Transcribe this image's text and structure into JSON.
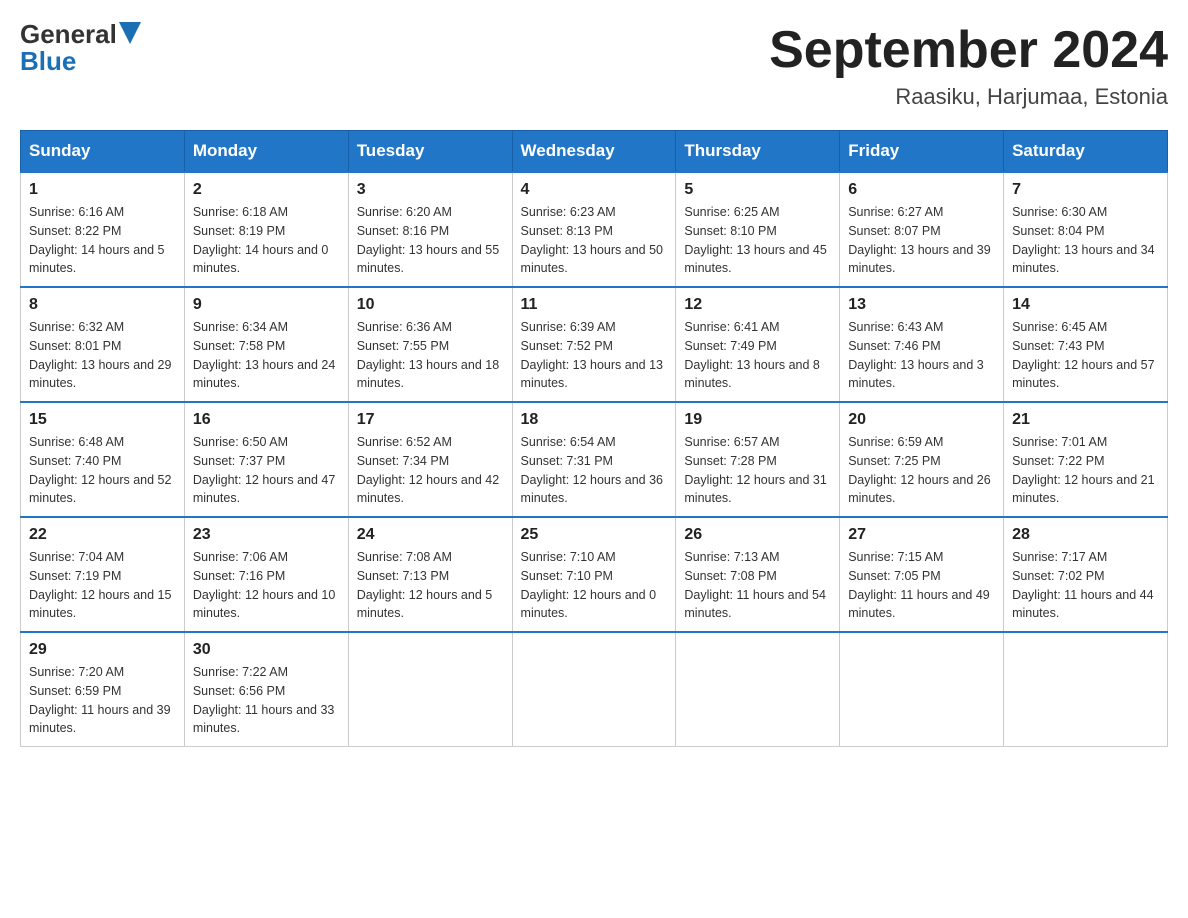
{
  "header": {
    "logo_general": "General",
    "logo_blue": "Blue",
    "title": "September 2024",
    "subtitle": "Raasiku, Harjumaa, Estonia"
  },
  "columns": [
    "Sunday",
    "Monday",
    "Tuesday",
    "Wednesday",
    "Thursday",
    "Friday",
    "Saturday"
  ],
  "weeks": [
    [
      {
        "day": "1",
        "sunrise": "Sunrise: 6:16 AM",
        "sunset": "Sunset: 8:22 PM",
        "daylight": "Daylight: 14 hours and 5 minutes."
      },
      {
        "day": "2",
        "sunrise": "Sunrise: 6:18 AM",
        "sunset": "Sunset: 8:19 PM",
        "daylight": "Daylight: 14 hours and 0 minutes."
      },
      {
        "day": "3",
        "sunrise": "Sunrise: 6:20 AM",
        "sunset": "Sunset: 8:16 PM",
        "daylight": "Daylight: 13 hours and 55 minutes."
      },
      {
        "day": "4",
        "sunrise": "Sunrise: 6:23 AM",
        "sunset": "Sunset: 8:13 PM",
        "daylight": "Daylight: 13 hours and 50 minutes."
      },
      {
        "day": "5",
        "sunrise": "Sunrise: 6:25 AM",
        "sunset": "Sunset: 8:10 PM",
        "daylight": "Daylight: 13 hours and 45 minutes."
      },
      {
        "day": "6",
        "sunrise": "Sunrise: 6:27 AM",
        "sunset": "Sunset: 8:07 PM",
        "daylight": "Daylight: 13 hours and 39 minutes."
      },
      {
        "day": "7",
        "sunrise": "Sunrise: 6:30 AM",
        "sunset": "Sunset: 8:04 PM",
        "daylight": "Daylight: 13 hours and 34 minutes."
      }
    ],
    [
      {
        "day": "8",
        "sunrise": "Sunrise: 6:32 AM",
        "sunset": "Sunset: 8:01 PM",
        "daylight": "Daylight: 13 hours and 29 minutes."
      },
      {
        "day": "9",
        "sunrise": "Sunrise: 6:34 AM",
        "sunset": "Sunset: 7:58 PM",
        "daylight": "Daylight: 13 hours and 24 minutes."
      },
      {
        "day": "10",
        "sunrise": "Sunrise: 6:36 AM",
        "sunset": "Sunset: 7:55 PM",
        "daylight": "Daylight: 13 hours and 18 minutes."
      },
      {
        "day": "11",
        "sunrise": "Sunrise: 6:39 AM",
        "sunset": "Sunset: 7:52 PM",
        "daylight": "Daylight: 13 hours and 13 minutes."
      },
      {
        "day": "12",
        "sunrise": "Sunrise: 6:41 AM",
        "sunset": "Sunset: 7:49 PM",
        "daylight": "Daylight: 13 hours and 8 minutes."
      },
      {
        "day": "13",
        "sunrise": "Sunrise: 6:43 AM",
        "sunset": "Sunset: 7:46 PM",
        "daylight": "Daylight: 13 hours and 3 minutes."
      },
      {
        "day": "14",
        "sunrise": "Sunrise: 6:45 AM",
        "sunset": "Sunset: 7:43 PM",
        "daylight": "Daylight: 12 hours and 57 minutes."
      }
    ],
    [
      {
        "day": "15",
        "sunrise": "Sunrise: 6:48 AM",
        "sunset": "Sunset: 7:40 PM",
        "daylight": "Daylight: 12 hours and 52 minutes."
      },
      {
        "day": "16",
        "sunrise": "Sunrise: 6:50 AM",
        "sunset": "Sunset: 7:37 PM",
        "daylight": "Daylight: 12 hours and 47 minutes."
      },
      {
        "day": "17",
        "sunrise": "Sunrise: 6:52 AM",
        "sunset": "Sunset: 7:34 PM",
        "daylight": "Daylight: 12 hours and 42 minutes."
      },
      {
        "day": "18",
        "sunrise": "Sunrise: 6:54 AM",
        "sunset": "Sunset: 7:31 PM",
        "daylight": "Daylight: 12 hours and 36 minutes."
      },
      {
        "day": "19",
        "sunrise": "Sunrise: 6:57 AM",
        "sunset": "Sunset: 7:28 PM",
        "daylight": "Daylight: 12 hours and 31 minutes."
      },
      {
        "day": "20",
        "sunrise": "Sunrise: 6:59 AM",
        "sunset": "Sunset: 7:25 PM",
        "daylight": "Daylight: 12 hours and 26 minutes."
      },
      {
        "day": "21",
        "sunrise": "Sunrise: 7:01 AM",
        "sunset": "Sunset: 7:22 PM",
        "daylight": "Daylight: 12 hours and 21 minutes."
      }
    ],
    [
      {
        "day": "22",
        "sunrise": "Sunrise: 7:04 AM",
        "sunset": "Sunset: 7:19 PM",
        "daylight": "Daylight: 12 hours and 15 minutes."
      },
      {
        "day": "23",
        "sunrise": "Sunrise: 7:06 AM",
        "sunset": "Sunset: 7:16 PM",
        "daylight": "Daylight: 12 hours and 10 minutes."
      },
      {
        "day": "24",
        "sunrise": "Sunrise: 7:08 AM",
        "sunset": "Sunset: 7:13 PM",
        "daylight": "Daylight: 12 hours and 5 minutes."
      },
      {
        "day": "25",
        "sunrise": "Sunrise: 7:10 AM",
        "sunset": "Sunset: 7:10 PM",
        "daylight": "Daylight: 12 hours and 0 minutes."
      },
      {
        "day": "26",
        "sunrise": "Sunrise: 7:13 AM",
        "sunset": "Sunset: 7:08 PM",
        "daylight": "Daylight: 11 hours and 54 minutes."
      },
      {
        "day": "27",
        "sunrise": "Sunrise: 7:15 AM",
        "sunset": "Sunset: 7:05 PM",
        "daylight": "Daylight: 11 hours and 49 minutes."
      },
      {
        "day": "28",
        "sunrise": "Sunrise: 7:17 AM",
        "sunset": "Sunset: 7:02 PM",
        "daylight": "Daylight: 11 hours and 44 minutes."
      }
    ],
    [
      {
        "day": "29",
        "sunrise": "Sunrise: 7:20 AM",
        "sunset": "Sunset: 6:59 PM",
        "daylight": "Daylight: 11 hours and 39 minutes."
      },
      {
        "day": "30",
        "sunrise": "Sunrise: 7:22 AM",
        "sunset": "Sunset: 6:56 PM",
        "daylight": "Daylight: 11 hours and 33 minutes."
      },
      null,
      null,
      null,
      null,
      null
    ]
  ]
}
